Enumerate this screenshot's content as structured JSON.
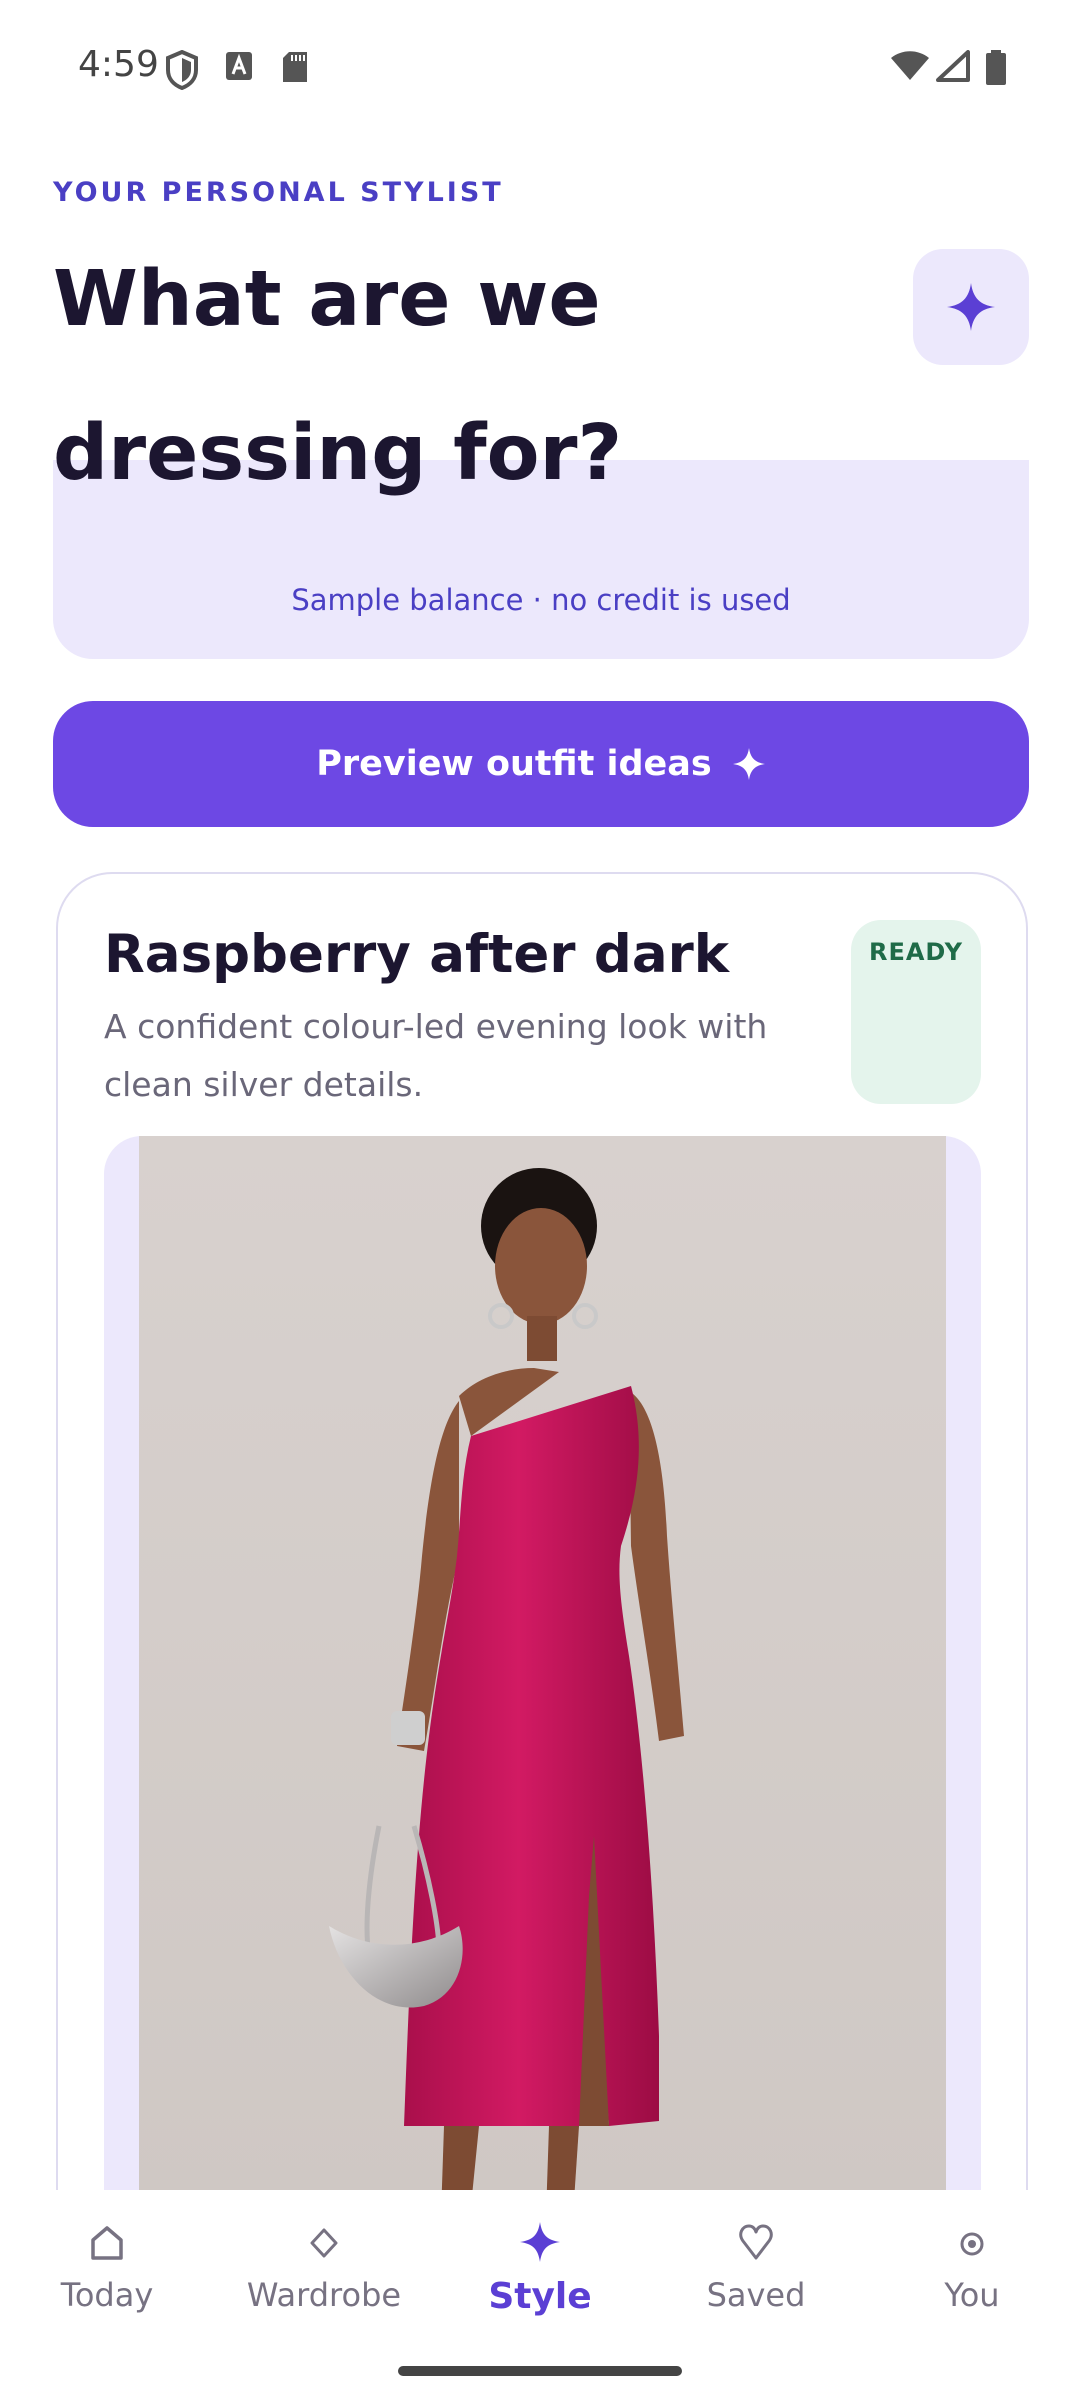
{
  "status_bar": {
    "time": "4:59",
    "icons": [
      "shield-icon",
      "a-icon",
      "sd-card-icon",
      "wifi-icon",
      "signal-icon",
      "battery-icon"
    ]
  },
  "header": {
    "eyebrow": "YOUR PERSONAL STYLIST",
    "title": "What are we dressing for?",
    "action_icon": "sparkle-icon"
  },
  "balance_card": {
    "note": "Sample balance · no credit is used"
  },
  "preview_button": {
    "label": "Preview outfit ideas",
    "icon": "sparkle-icon"
  },
  "outfit": {
    "title": "Raspberry after dark",
    "description": "A confident colour-led evening look with clean silver details.",
    "status_badge": "READY",
    "image_icon": "outfit-photo"
  },
  "bottom_nav": {
    "items": [
      {
        "label": "Today",
        "icon": "home-icon",
        "active": false
      },
      {
        "label": "Wardrobe",
        "icon": "diamond-icon",
        "active": false
      },
      {
        "label": "Style",
        "icon": "sparkle-icon",
        "active": true
      },
      {
        "label": "Saved",
        "icon": "heart-icon",
        "active": false
      },
      {
        "label": "You",
        "icon": "profile-icon",
        "active": false
      }
    ]
  },
  "colors": {
    "accent": "#6d48e4",
    "accent_text": "#4a3fc4",
    "soft_lavender": "#ece8fc",
    "ready_bg": "#e4f4ec",
    "ready_text": "#1f6b48",
    "dress": "#c8145a"
  }
}
